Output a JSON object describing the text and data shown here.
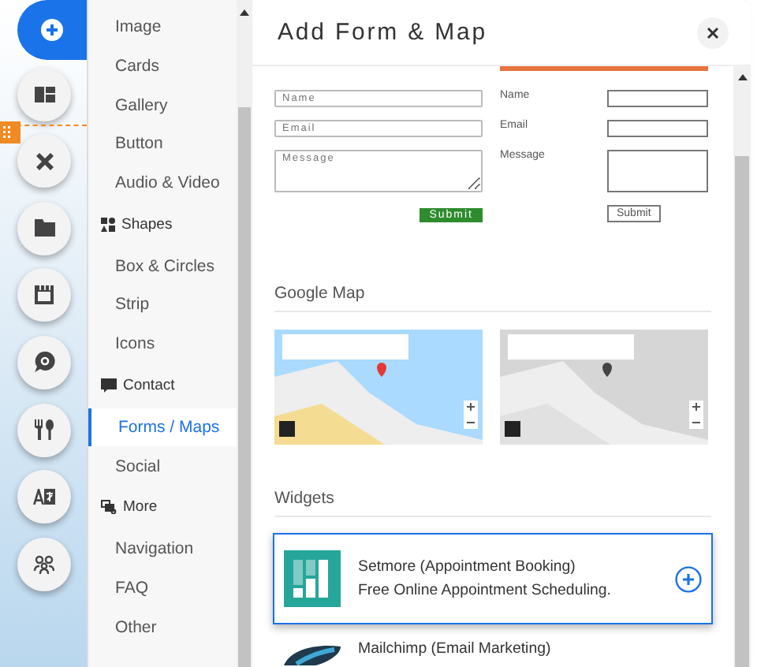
{
  "rail": [
    {
      "selected": true
    },
    {
      "selected": false
    },
    {
      "selected": false
    },
    {
      "selected": false
    },
    {
      "selected": false
    },
    {
      "selected": false
    },
    {
      "selected": false
    },
    {
      "selected": false
    },
    {
      "selected": false
    }
  ],
  "menu": [
    {
      "kind": "item",
      "label": "Image",
      "selected": false
    },
    {
      "kind": "item",
      "label": "Cards",
      "selected": false
    },
    {
      "kind": "item",
      "label": "Gallery",
      "selected": false
    },
    {
      "kind": "item",
      "label": "Button",
      "selected": false
    },
    {
      "kind": "item",
      "label": "Audio & Video",
      "selected": false
    },
    {
      "kind": "heading",
      "label": "Shapes"
    },
    {
      "kind": "item",
      "label": "Box & Circles",
      "selected": false
    },
    {
      "kind": "item",
      "label": "Strip",
      "selected": false
    },
    {
      "kind": "item",
      "label": "Icons",
      "selected": false
    },
    {
      "kind": "heading",
      "label": "Contact"
    },
    {
      "kind": "item",
      "label": "Forms / Maps",
      "selected": true
    },
    {
      "kind": "item",
      "label": "Social",
      "selected": false
    },
    {
      "kind": "heading",
      "label": "More"
    },
    {
      "kind": "item",
      "label": "Navigation",
      "selected": false
    },
    {
      "kind": "item",
      "label": "FAQ",
      "selected": false
    },
    {
      "kind": "item",
      "label": "Other",
      "selected": false
    }
  ],
  "dialog": {
    "title": "Add Form & Map",
    "form_templates": [
      {
        "kind": "placeholder",
        "fields": [
          {
            "placeholder": "Name",
            "multiline": false
          },
          {
            "placeholder": "Email",
            "multiline": false
          },
          {
            "placeholder": "Message",
            "multiline": true
          }
        ],
        "submit": "Submit"
      },
      {
        "kind": "labeled",
        "fields": [
          {
            "label": "Name",
            "multiline": false
          },
          {
            "label": "Email",
            "multiline": false
          },
          {
            "label": "Message",
            "multiline": true
          }
        ],
        "submit": "Submit"
      }
    ],
    "map_section": {
      "heading": "Google Map",
      "maps": [
        {
          "kind": "color"
        },
        {
          "kind": "grayscale"
        }
      ]
    },
    "widget_section": {
      "heading": "Widgets",
      "widgets": [
        {
          "kind": "setmore",
          "title": "Setmore (Appointment Booking)",
          "description": "Free Online Appointment Scheduling.",
          "selected": true
        },
        {
          "kind": "mailchimp",
          "title": "Mailchimp (Email Marketing)",
          "selected": false
        }
      ]
    }
  }
}
